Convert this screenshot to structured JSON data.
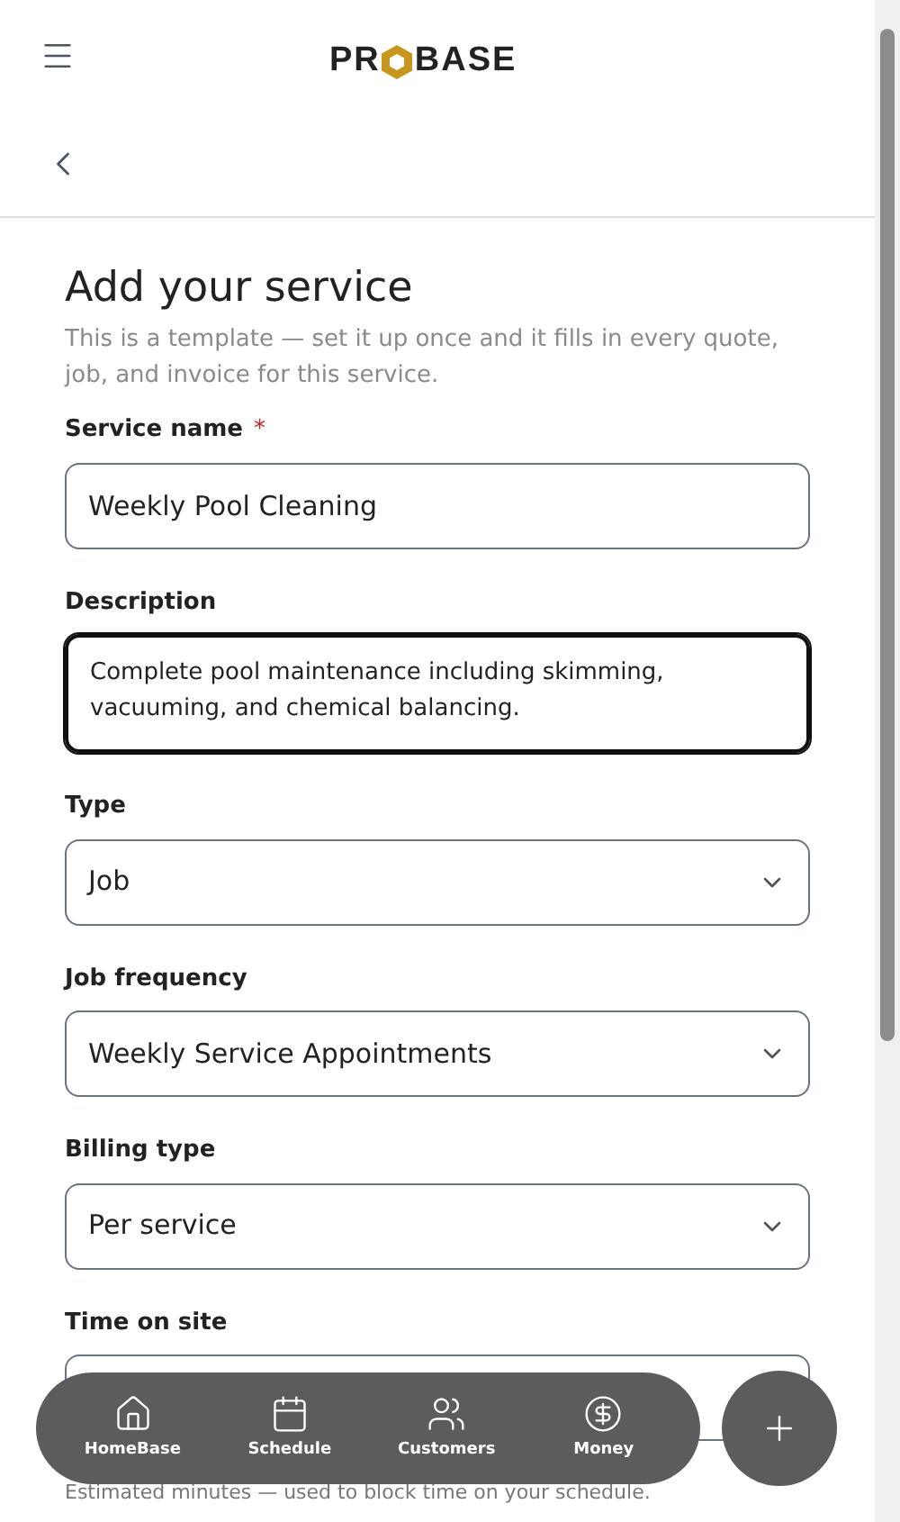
{
  "header": {
    "logo": {
      "left": "PR",
      "right": "BASE"
    }
  },
  "form": {
    "title": "Add your service",
    "subtitle": "This is a template — set it up once and it fills in every quote, job, and invoice for this service.",
    "fields": [
      {
        "kind": "text",
        "label": "Service name",
        "required_mark": "*",
        "value": "Weekly Pool Cleaning",
        "focused": false
      },
      {
        "kind": "textarea",
        "label": "Description",
        "value": "Complete pool maintenance including skimming, vacuuming, and chemical balancing.",
        "focused": true
      },
      {
        "kind": "select",
        "label": "Type",
        "value": "Job",
        "focused": false
      },
      {
        "kind": "select",
        "label": "Job frequency",
        "value": "Weekly Service Appointments",
        "focused": false
      },
      {
        "kind": "select",
        "label": "Billing type",
        "value": "Per service",
        "focused": false
      },
      {
        "kind": "text",
        "label": "Time on site",
        "focused": false,
        "hint": "Estimated minutes — used to block time on your schedule."
      }
    ]
  },
  "bottom_nav": {
    "items": [
      {
        "kind": "home",
        "label": "HomeBase"
      },
      {
        "kind": "calendar",
        "label": "Schedule"
      },
      {
        "kind": "people",
        "label": "Customers"
      },
      {
        "kind": "money",
        "label": "Money"
      }
    ]
  }
}
